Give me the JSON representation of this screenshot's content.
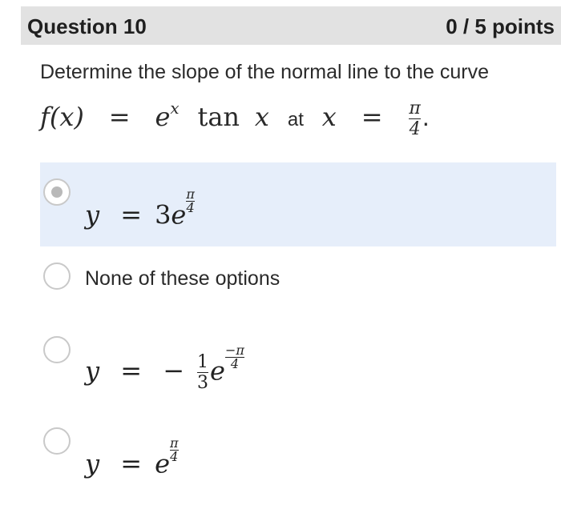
{
  "header": {
    "title": "Question 10",
    "points": "0 / 5 points"
  },
  "question": {
    "text": "Determine the slope of the normal line to the curve",
    "math": {
      "fx": "f(x)",
      "eq": "=",
      "e": "e",
      "x": "x",
      "tan": "tan",
      "at": "at",
      "pi": "π",
      "four": "4",
      "period": "."
    }
  },
  "options": [
    {
      "id": "a",
      "selected": true,
      "label": "y = 3e^(π/4)"
    },
    {
      "id": "b",
      "selected": false,
      "label": "None of these options"
    },
    {
      "id": "c",
      "selected": false,
      "label": "y = −(1/3)e^(−π/4)"
    },
    {
      "id": "d",
      "selected": false,
      "label": "y = e^(π/4)"
    }
  ],
  "glyphs": {
    "y": "y",
    "eq": "=",
    "three": "3",
    "e": "e",
    "pi": "π",
    "four": "4",
    "minus": "−",
    "one": "1",
    "neg": "−"
  },
  "colors": {
    "header_bg": "#e2e2e2",
    "selected_bg": "#e6eefa",
    "radio_border": "#c9c9c9"
  }
}
